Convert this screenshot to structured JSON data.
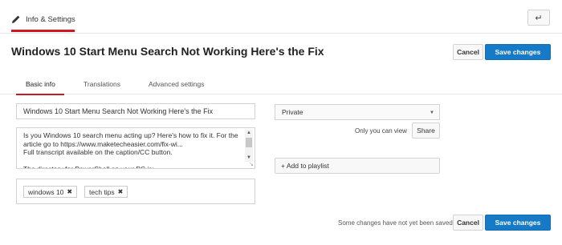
{
  "header": {
    "tab_label": "Info & Settings",
    "back_icon": "back-arrow-icon"
  },
  "video": {
    "title": "Windows 10 Start Menu Search Not Working Here's the Fix"
  },
  "actions": {
    "cancel_label": "Cancel",
    "save_label": "Save changes"
  },
  "tabs": [
    {
      "label": "Basic info",
      "active": true
    },
    {
      "label": "Translations",
      "active": false
    },
    {
      "label": "Advanced settings",
      "active": false
    }
  ],
  "form": {
    "title_value": "Windows 10 Start Menu Search Not Working  Here's the Fix",
    "description_value": "Is you Windows 10 search menu acting up? Here's how to fix it. For the article go to https://www.maketecheasier.com/fix-wi...\nFull transcript available on the caption/CC button.\n\nThe directory for PowerShell on your PC is:",
    "tags": [
      "windows 10",
      "tech tips"
    ]
  },
  "privacy": {
    "selected": "Private",
    "note": "Only you can view",
    "share_label": "Share"
  },
  "playlist": {
    "label": "+ Add to playlist"
  },
  "footer": {
    "unsaved_note": "Some changes have not yet been saved.",
    "cancel_label": "Cancel",
    "save_label": "Save changes"
  },
  "colors": {
    "accent_red": "#cc181e",
    "save_blue": "#167ac6"
  }
}
